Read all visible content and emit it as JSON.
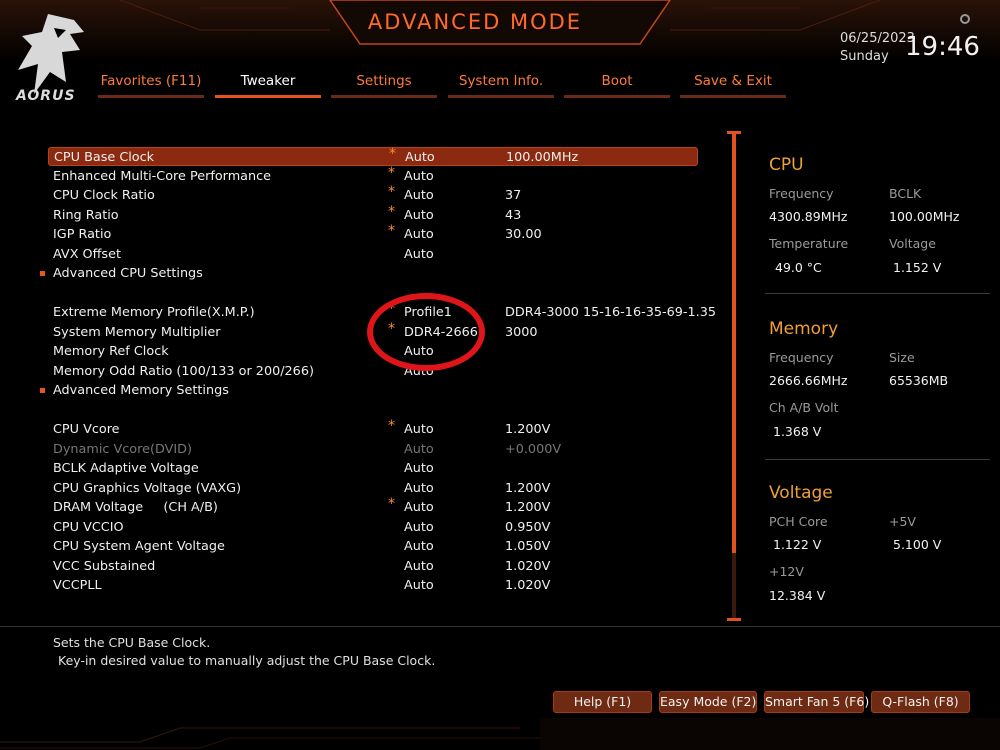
{
  "header": {
    "brand": "AORUS",
    "mode_title": "ADVANCED MODE",
    "date": "06/25/2023",
    "day": "Sunday",
    "time": "19:46"
  },
  "tabs": [
    {
      "label": "Favorites (F11)"
    },
    {
      "label": "Tweaker",
      "active": true
    },
    {
      "label": "Settings"
    },
    {
      "label": "System Info."
    },
    {
      "label": "Boot"
    },
    {
      "label": "Save & Exit"
    }
  ],
  "settings": [
    {
      "name": "CPU Base Clock",
      "star": "*",
      "setting": "Auto",
      "value": "100.00MHz"
    },
    {
      "name": "Enhanced Multi-Core Performance",
      "star": "*",
      "setting": "Auto",
      "value": ""
    },
    {
      "name": "CPU Clock Ratio",
      "star": "*",
      "setting": "Auto",
      "value": "37"
    },
    {
      "name": "Ring Ratio",
      "star": "*",
      "setting": "Auto",
      "value": "43"
    },
    {
      "name": "IGP Ratio",
      "star": "*",
      "setting": "Auto",
      "value": "30.00"
    },
    {
      "name": "AVX Offset",
      "star": "",
      "setting": "Auto",
      "value": ""
    },
    {
      "name": "Advanced CPU Settings",
      "star": "",
      "setting": "",
      "value": ""
    },
    {
      "name": "Extreme Memory Profile(X.M.P.)",
      "star": "*",
      "setting": "Profile1",
      "value": "DDR4-3000 15-16-16-35-69-1.35"
    },
    {
      "name": "System Memory Multiplier",
      "star": "*",
      "setting": "DDR4-2666",
      "value": "3000"
    },
    {
      "name": "Memory Ref Clock",
      "star": "",
      "setting": "Auto",
      "value": ""
    },
    {
      "name": "Memory Odd Ratio (100/133 or 200/266)",
      "star": "",
      "setting": "Auto",
      "value": ""
    },
    {
      "name": "Advanced Memory Settings",
      "star": "",
      "setting": "",
      "value": ""
    },
    {
      "name": "CPU Vcore",
      "star": "*",
      "setting": "Auto",
      "value": "1.200V"
    },
    {
      "name": "Dynamic Vcore(DVID)",
      "star": "",
      "setting": "Auto",
      "value": "+0.000V"
    },
    {
      "name": "BCLK Adaptive Voltage",
      "star": "",
      "setting": "Auto",
      "value": ""
    },
    {
      "name": "CPU Graphics Voltage (VAXG)",
      "star": "",
      "setting": "Auto",
      "value": "1.200V"
    },
    {
      "name": "DRAM Voltage     (CH A/B)",
      "star": "*",
      "setting": "Auto",
      "value": "1.200V"
    },
    {
      "name": "CPU VCCIO",
      "star": "",
      "setting": "Auto",
      "value": "0.950V"
    },
    {
      "name": "CPU System Agent Voltage",
      "star": "",
      "setting": "Auto",
      "value": "1.050V"
    },
    {
      "name": "VCC Substained",
      "star": "",
      "setting": "Auto",
      "value": "1.020V"
    },
    {
      "name": "VCCPLL",
      "star": "",
      "setting": "Auto",
      "value": "1.020V"
    }
  ],
  "panel": {
    "cpu": {
      "title": "CPU",
      "frequency_label": "Frequency",
      "frequency": "4300.89MHz",
      "bclk_label": "BCLK",
      "bclk": "100.00MHz",
      "temperature_label": "Temperature",
      "temperature": "49.0 °C",
      "voltage_label": "Voltage",
      "voltage": "1.152 V"
    },
    "memory": {
      "title": "Memory",
      "frequency_label": "Frequency",
      "frequency": "2666.66MHz",
      "size_label": "Size",
      "size": "65536MB",
      "chab_label": "Ch A/B Volt",
      "chab": "1.368 V"
    },
    "voltage": {
      "title": "Voltage",
      "pch_label": "PCH Core",
      "pch": "1.122 V",
      "p5v_label": "+5V",
      "p5v": "5.100 V",
      "p12v_label": "+12V",
      "p12v": "12.384 V"
    }
  },
  "help": {
    "line1": "Sets the CPU Base Clock.",
    "line2": "Key-in desired value to manually adjust the CPU Base Clock."
  },
  "footer": [
    {
      "label": "Help (F1)"
    },
    {
      "label": "Easy Mode (F2)"
    },
    {
      "label": "Smart Fan 5 (F6)"
    },
    {
      "label": "Q-Flash (F8)"
    }
  ],
  "colors": {
    "accent": "#e6521e",
    "title_orange": "#ff6a2a",
    "section_gold": "#f0a036",
    "selection": "#8b2a10",
    "annotation_red": "#e0151a"
  }
}
